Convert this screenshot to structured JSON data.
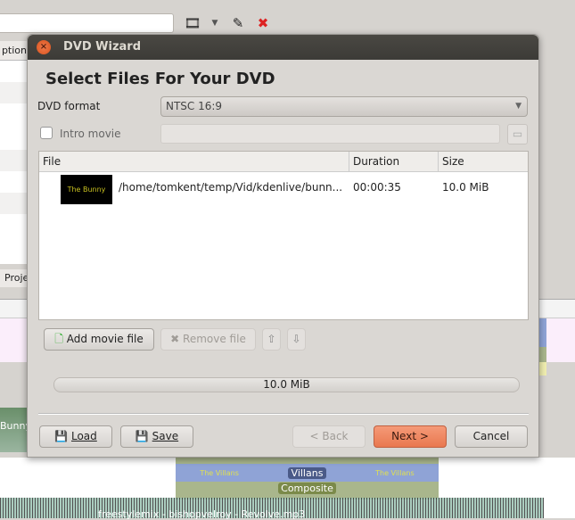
{
  "background": {
    "left_tab": "ption",
    "project_tab": "Proje",
    "clip_label": "Bunny",
    "villans_small": "The Villans",
    "villans_badge": "Villans",
    "composite": "Composite",
    "audio_label": "freestylemix - bishopvelroy - Revolve.mp3"
  },
  "dialog": {
    "title": "DVD Wizard",
    "heading": "Select Files For Your DVD",
    "format_label": "DVD format",
    "format_value": "NTSC 16:9",
    "intro_label": "Intro movie",
    "intro_checked": false,
    "table": {
      "columns": [
        "File",
        "Duration",
        "Size"
      ],
      "rows": [
        {
          "thumb_text": "The Bunny",
          "file": "/home/tomkent/temp/Vid/kdenlive/bunn...",
          "duration": "00:00:35",
          "size": "10.0 MiB"
        }
      ]
    },
    "add_label": "Add movie file",
    "remove_label": "Remove file",
    "total_size": "10.0 MiB",
    "load_label": "Load",
    "save_label": "Save",
    "back_label": "< Back",
    "next_label": "Next >",
    "cancel_label": "Cancel",
    "accent": "#e9784f"
  }
}
